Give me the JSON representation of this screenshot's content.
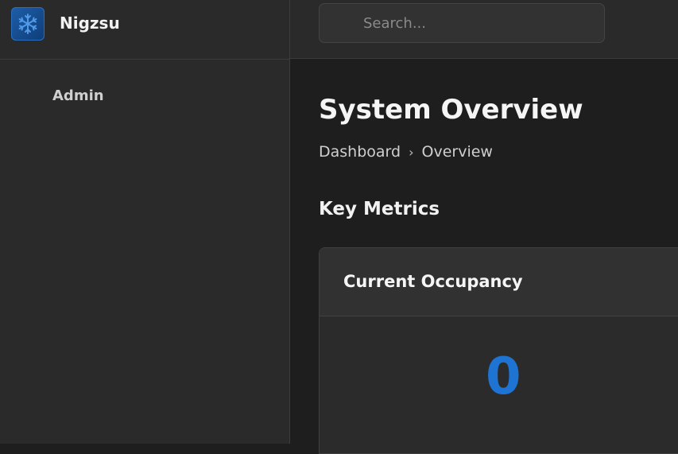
{
  "app": {
    "name": "Nigzsu",
    "logo_icon": "snowflake-logo-icon",
    "accent_color": "#1e74d2"
  },
  "sidebar": {
    "items": [
      {
        "label": "Admin"
      }
    ]
  },
  "header": {
    "search": {
      "placeholder": "Search...",
      "value": ""
    }
  },
  "main": {
    "title": "System Overview",
    "breadcrumb": {
      "items": [
        "Dashboard",
        "Overview"
      ],
      "separator": "›"
    },
    "section_title": "Key Metrics",
    "cards": [
      {
        "title": "Current Occupancy",
        "value": "0",
        "subtitle": ""
      }
    ]
  }
}
